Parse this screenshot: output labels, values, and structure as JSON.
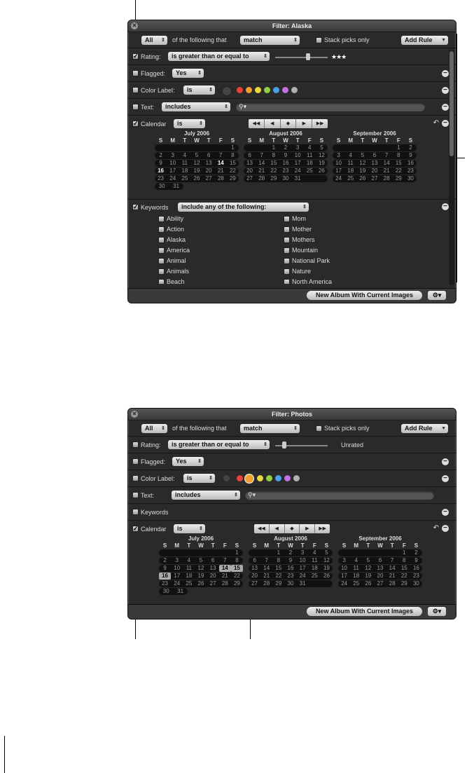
{
  "w1": {
    "title": "Filter: Alaska",
    "match_all": "All",
    "of_following": "of the following that",
    "match": "match",
    "stack_picks": "Stack picks only",
    "add_rule": "Add Rule",
    "rating_label": "Rating:",
    "rating_op": "is greater than or equal to",
    "rating_stars": "★★★",
    "flagged_label": "Flagged:",
    "flagged_val": "Yes",
    "color_label": "Color Label:",
    "color_op": "is",
    "text_label": "Text:",
    "text_op": "includes",
    "calendar_label": "Calendar",
    "calendar_op": "is",
    "keywords_label": "Keywords",
    "keywords_op": "include any of the following:",
    "keywords_left": [
      "Ability",
      "Action",
      "Alaska",
      "America",
      "Animal",
      "Animals",
      "Beach"
    ],
    "keywords_right": [
      "Mom",
      "Mother",
      "Mothers",
      "Mountain",
      "National Park",
      "Nature",
      "North America"
    ],
    "new_album": "New Album With Current Images"
  },
  "w2": {
    "title": "Filter: Photos",
    "match_all": "All",
    "of_following": "of the following that",
    "match": "match",
    "stack_picks": "Stack picks only",
    "add_rule": "Add Rule",
    "rating_label": "Rating:",
    "rating_op": "is greater than or equal to",
    "rating_val": "Unrated",
    "flagged_label": "Flagged:",
    "flagged_val": "Yes",
    "color_label": "Color Label:",
    "color_op": "is",
    "text_label": "Text:",
    "text_op": "includes",
    "keywords_label": "Keywords",
    "calendar_label": "Calendar",
    "calendar_op": "is",
    "new_album": "New Album With Current Images"
  },
  "calendar": {
    "dow": [
      "S",
      "M",
      "T",
      "W",
      "T",
      "F",
      "S"
    ],
    "months": [
      {
        "title": "July 2006",
        "weeks": [
          [
            "",
            "",
            "",
            "",
            "",
            "",
            "1"
          ],
          [
            "2",
            "3",
            "4",
            "5",
            "6",
            "7",
            "8"
          ],
          [
            "9",
            "10",
            "11",
            "12",
            "13",
            "14",
            "15"
          ],
          [
            "16",
            "17",
            "18",
            "19",
            "20",
            "21",
            "22"
          ],
          [
            "23",
            "24",
            "25",
            "26",
            "27",
            "28",
            "29"
          ],
          [
            "30",
            "31",
            "",
            "",
            "",
            "",
            ""
          ]
        ]
      },
      {
        "title": "August 2006",
        "weeks": [
          [
            "",
            "",
            "1",
            "2",
            "3",
            "4",
            "5"
          ],
          [
            "6",
            "7",
            "8",
            "9",
            "10",
            "11",
            "12"
          ],
          [
            "13",
            "14",
            "15",
            "16",
            "17",
            "18",
            "19"
          ],
          [
            "20",
            "21",
            "22",
            "23",
            "24",
            "25",
            "26"
          ],
          [
            "27",
            "28",
            "29",
            "30",
            "31",
            "",
            ""
          ]
        ]
      },
      {
        "title": "September 2006",
        "weeks": [
          [
            "",
            "",
            "",
            "",
            "",
            "1",
            "2"
          ],
          [
            "3",
            "4",
            "5",
            "6",
            "7",
            "8",
            "9"
          ],
          [
            "10",
            "11",
            "12",
            "13",
            "14",
            "15",
            "16"
          ],
          [
            "17",
            "18",
            "19",
            "20",
            "21",
            "22",
            "23"
          ],
          [
            "24",
            "25",
            "26",
            "27",
            "28",
            "29",
            "30"
          ]
        ]
      }
    ]
  },
  "colors": {
    "label_dots": [
      "#444444",
      "#e8413c",
      "#f0a030",
      "#e8d840",
      "#8ed040",
      "#4aa0e8",
      "#c070e0",
      "#b0b0b0"
    ]
  }
}
